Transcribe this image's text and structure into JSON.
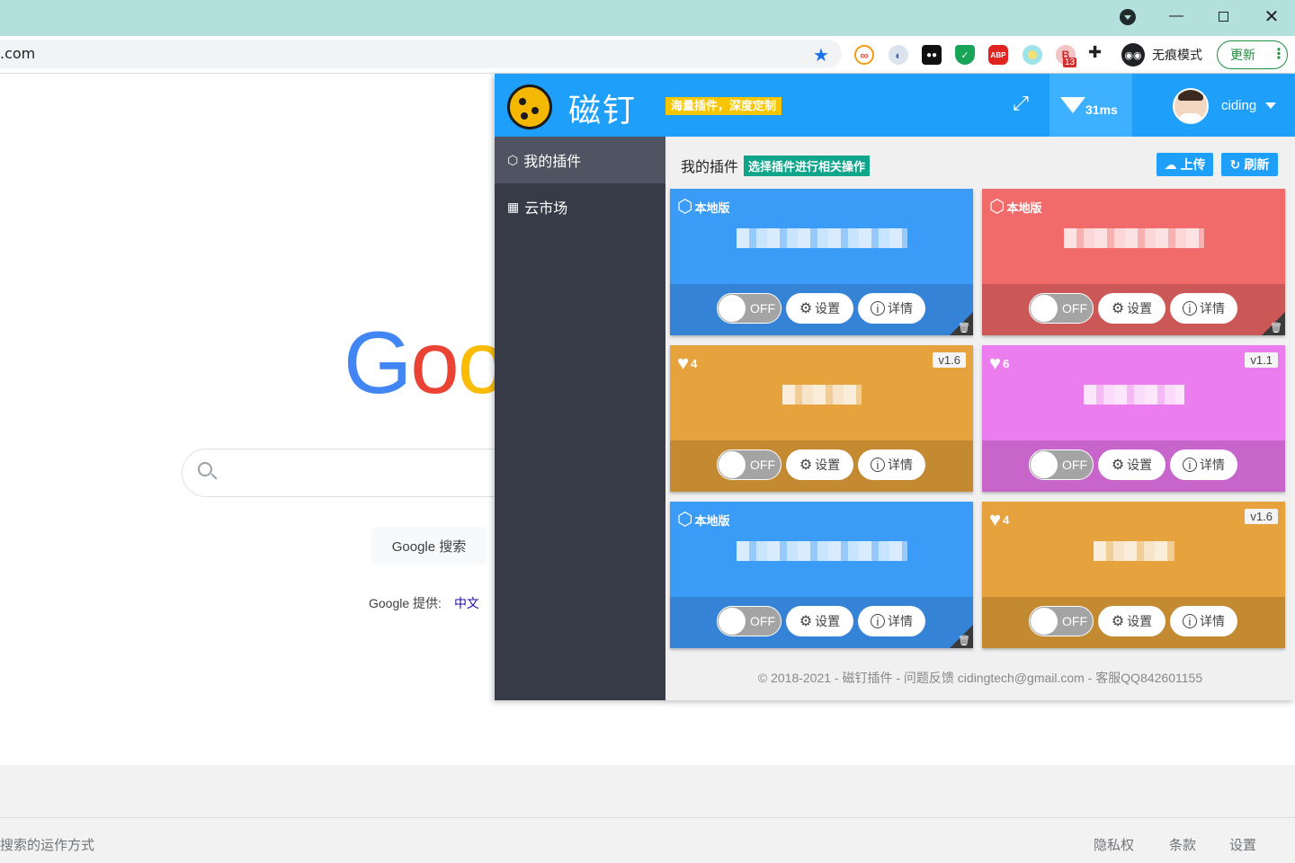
{
  "browser": {
    "url": ".com",
    "incognito_label": "无痕模式",
    "update_label": "更新",
    "abp_label": "ABP",
    "badge_count": "13"
  },
  "google": {
    "logo": "Goo",
    "search_button": "Google 搜索",
    "offered_in": "Google 提供:",
    "offered_lang": "中文",
    "footer_left": "搜索的运作方式",
    "footer_links": [
      "隐私权",
      "条款",
      "设置"
    ]
  },
  "popup": {
    "brand": "磁钉",
    "slogan": "海量插件，深度定制",
    "ping": "31ms",
    "username": "ciding",
    "sidebar": [
      {
        "label": "我的插件",
        "icon": "cube-icon"
      },
      {
        "label": "云市场",
        "icon": "grid-icon"
      }
    ],
    "main_title": "我的插件",
    "main_tag": "选择插件进行相关操作",
    "upload_label": "上传",
    "refresh_label": "刷新",
    "cards": [
      {
        "kind": "local",
        "label": "本地版",
        "likes": "",
        "version": "",
        "top": "#3b9cf8",
        "bottom": "#3583d6",
        "toggle": "OFF",
        "settings": "设置",
        "details": "详情",
        "deletable": true
      },
      {
        "kind": "local",
        "label": "本地版",
        "likes": "",
        "version": "",
        "top": "#f26b6b",
        "bottom": "#cc5757",
        "toggle": "OFF",
        "settings": "设置",
        "details": "详情",
        "deletable": true
      },
      {
        "kind": "cloud",
        "label": "",
        "likes": "4",
        "version": "v1.6",
        "top": "#e5a23d",
        "bottom": "#c48a32",
        "toggle": "OFF",
        "settings": "设置",
        "details": "详情",
        "deletable": false
      },
      {
        "kind": "cloud",
        "label": "",
        "likes": "6",
        "version": "v1.1",
        "top": "#ec7def",
        "bottom": "#c865cb",
        "toggle": "OFF",
        "settings": "设置",
        "details": "详情",
        "deletable": false
      },
      {
        "kind": "local",
        "label": "本地版",
        "likes": "",
        "version": "",
        "top": "#3b9cf8",
        "bottom": "#3583d6",
        "toggle": "OFF",
        "settings": "设置",
        "details": "详情",
        "deletable": true
      },
      {
        "kind": "cloud",
        "label": "",
        "likes": "4",
        "version": "v1.6",
        "top": "#e5a23d",
        "bottom": "#c48a32",
        "toggle": "OFF",
        "settings": "设置",
        "details": "详情",
        "deletable": false
      }
    ],
    "copyright": "© 2018-2021 - 磁钉插件 - 问题反馈 cidingtech@gmail.com - 客服QQ842601155"
  }
}
